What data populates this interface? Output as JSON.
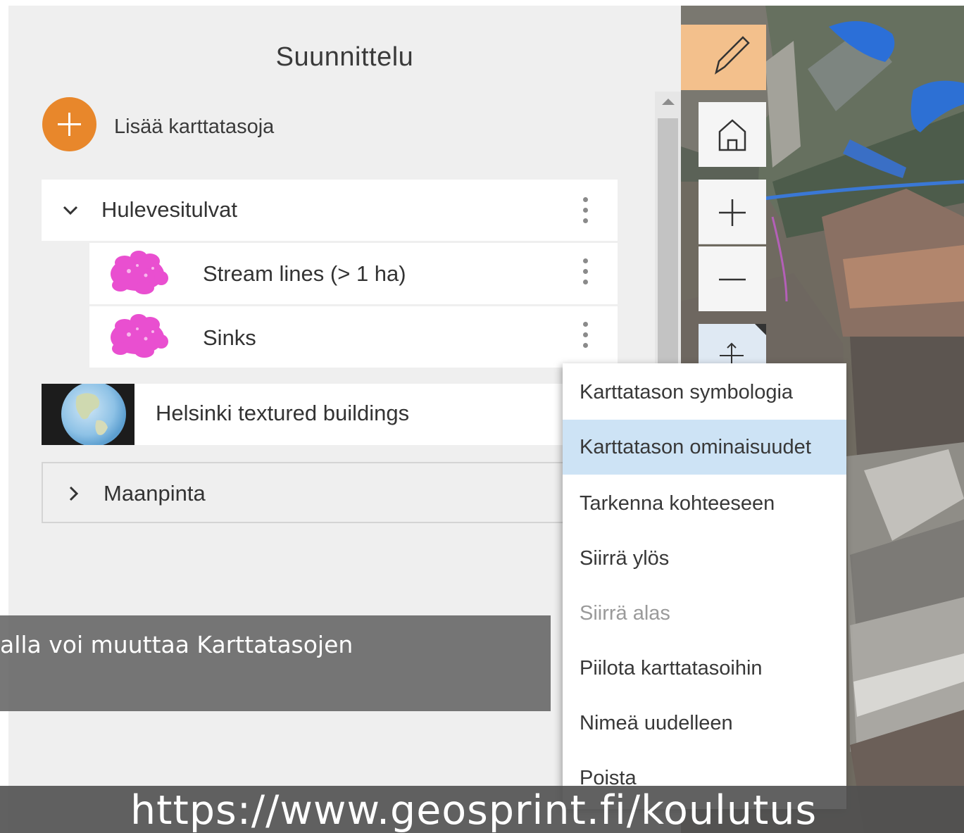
{
  "panel": {
    "title": "Suunnittelu",
    "add_layers_label": "Lisää karttatasoja"
  },
  "layers": {
    "group": {
      "label": "Hulevesitulvat",
      "expanded": true
    },
    "children": [
      {
        "label": "Stream lines (> 1 ha)",
        "swatch_color": "#e94fd0"
      },
      {
        "label": "Sinks",
        "swatch_color": "#e94fd0"
      }
    ],
    "buildings": {
      "label": "Helsinki textured buildings"
    },
    "ground": {
      "label": "Maanpinta",
      "expanded": false
    }
  },
  "map_tools": {
    "edit_icon": "pencil-icon",
    "home_icon": "home-icon",
    "zoom_in_icon": "plus-icon",
    "zoom_out_icon": "minus-icon",
    "pan_icon": "pan-icon"
  },
  "context_menu": {
    "items": [
      {
        "label": "Karttatason symbologia",
        "state": "normal"
      },
      {
        "label": "Karttatason ominaisuudet",
        "state": "active"
      },
      {
        "label": "Tarkenna kohteeseen",
        "state": "normal"
      },
      {
        "label": "Siirrä ylös",
        "state": "normal"
      },
      {
        "label": "Siirrä alas",
        "state": "disabled"
      },
      {
        "label": "Piilota karttatasoihin",
        "state": "normal"
      },
      {
        "label": "Nimeä uudelleen",
        "state": "normal"
      },
      {
        "label": "Poista",
        "state": "normal"
      }
    ]
  },
  "caption": {
    "text": "alla voi muuttaa Karttatasojen"
  },
  "banner": {
    "text": "https://www.geosprint.fi/koulutus"
  },
  "colors": {
    "accent_orange": "#e8872b",
    "edit_tool_bg": "#f3c08c",
    "menu_active_bg": "#cde3f5"
  }
}
